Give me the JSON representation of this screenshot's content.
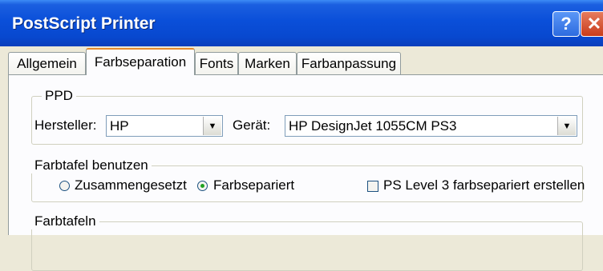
{
  "window": {
    "title": "PostScript Printer"
  },
  "titlebar_buttons": {
    "help": "?",
    "close": "✕"
  },
  "tabs": [
    {
      "label": "Allgemein",
      "active": false
    },
    {
      "label": "Farbseparation",
      "active": true
    },
    {
      "label": "Fonts",
      "active": false
    },
    {
      "label": "Marken",
      "active": false
    },
    {
      "label": "Farbanpassung",
      "active": false
    }
  ],
  "ppd": {
    "group_label": "PPD",
    "manufacturer_label": "Hersteller:",
    "manufacturer_value": "HP",
    "device_label": "Gerät:",
    "device_value": "HP DesignJet 1055CM PS3"
  },
  "farbtafel": {
    "group_label": "Farbtafel benutzen",
    "option_composite": "Zusammengesetzt",
    "option_separated": "Farbsepariert",
    "selected": "Farbsepariert",
    "ps_level3_label": "PS Level 3 farbsepariert erstellen",
    "ps_level3_checked": false
  },
  "farbtafeln": {
    "group_label": "Farbtafeln"
  }
}
